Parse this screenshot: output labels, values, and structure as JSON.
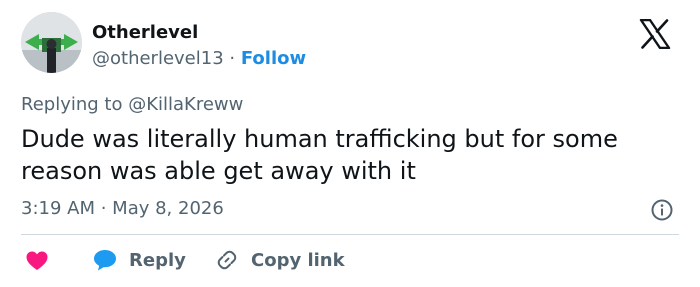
{
  "author": {
    "name": "Otherlevel",
    "handle": "@otherlevel13",
    "separator": " · ",
    "follow_label": "Follow"
  },
  "reply_context": {
    "prefix": "Replying to ",
    "target": "@KillaKreww"
  },
  "post": {
    "text": "Dude was literally human trafficking but for some reason was able get away with it"
  },
  "meta": {
    "time": "3:19 AM",
    "separator": " · ",
    "date": "May 8, 2026"
  },
  "actions": {
    "reply_label": "Reply",
    "copy_label": "Copy link"
  },
  "icons": {
    "logo": "x-logo-icon",
    "info": "info-icon",
    "like": "heart-icon",
    "reply": "speech-bubble-icon",
    "copy": "link-icon"
  },
  "colors": {
    "follow": "#1d8ce2",
    "like": "#f91880",
    "reply": "#1d9bf0",
    "muted": "#536471",
    "text": "#0f1419"
  }
}
